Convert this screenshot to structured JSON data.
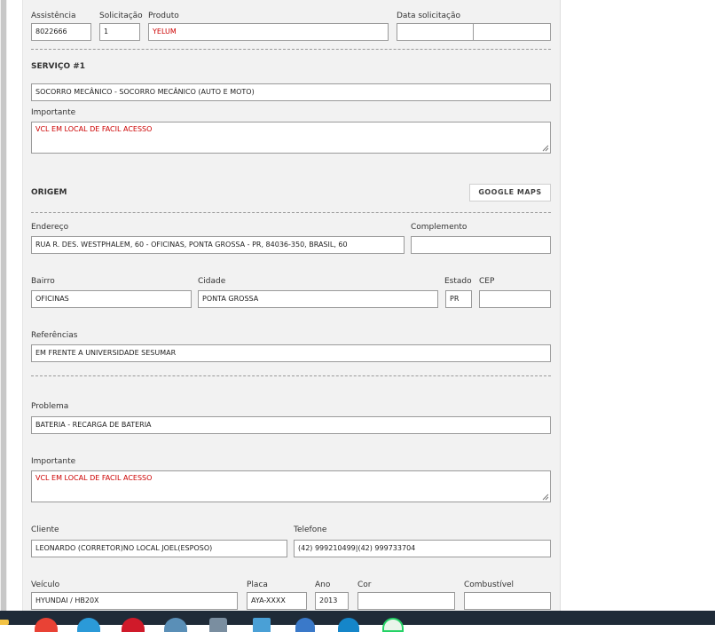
{
  "header": {
    "assistencia_label": "Assistência",
    "assistencia_value": "8022666",
    "solicitacao_label": "Solicitação",
    "solicitacao_value": "1",
    "produto_label": "Produto",
    "produto_value": "YELUM",
    "data_label": "Data solicitação",
    "data_value": "",
    "hora_value": ""
  },
  "servico": {
    "title": "SERVIÇO #1",
    "value": "SOCORRO MECÂNICO - SOCORRO MECÂNICO (AUTO E MOTO)",
    "importante_label": "Importante",
    "importante_value": "VCL EM LOCAL DE FACIL ACESSO"
  },
  "origem": {
    "title": "ORIGEM",
    "maps_button": "GOOGLE MAPS",
    "endereco_label": "Endereço",
    "endereco_value": "RUA R. DES. WESTPHALEM, 60 - OFICINAS, PONTA GROSSA - PR, 84036-350, BRASIL, 60",
    "complemento_label": "Complemento",
    "complemento_value": "",
    "bairro_label": "Bairro",
    "bairro_value": "OFICINAS",
    "cidade_label": "Cidade",
    "cidade_value": "PONTA GROSSA",
    "estado_label": "Estado",
    "estado_value": "PR",
    "cep_label": "CEP",
    "cep_value": "",
    "referencias_label": "Referências",
    "referencias_value": "EM FRENTE A UNIVERSIDADE SESUMAR"
  },
  "detalhes": {
    "problema_label": "Problema",
    "problema_value": "BATERIA - RECARGA DE BATERIA",
    "importante_label": "Importante",
    "importante_value": "VCL EM LOCAL DE FACIL ACESSO",
    "cliente_label": "Cliente",
    "cliente_value": "LEONARDO (CORRETOR)NO LOCAL JOEL(ESPOSO)",
    "telefone_label": "Telefone",
    "telefone_value": "(42) 999210499|(42) 999733704",
    "veiculo_label": "Veículo",
    "veiculo_value": "HYUNDAI / HB20X",
    "placa_label": "Placa",
    "placa_value": "AYA-XXXX",
    "ano_label": "Ano",
    "ano_value": "2013",
    "cor_label": "Cor",
    "cor_value": "",
    "combustivel_label": "Combustível",
    "combustivel_value": ""
  },
  "taskbar": {
    "icons": [
      "file-explorer-icon",
      "chrome-icon",
      "edge-icon",
      "opera-icon",
      "search-app-icon",
      "notepad-icon",
      "window-icon",
      "browser-icon",
      "app-icon",
      "whatsapp-icon"
    ]
  }
}
